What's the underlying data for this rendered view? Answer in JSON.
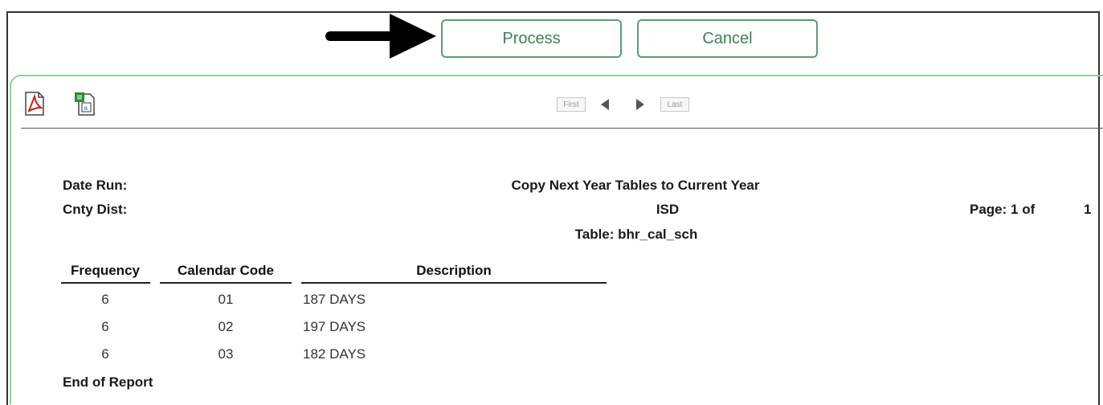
{
  "actions": {
    "process_label": "Process",
    "cancel_label": "Cancel"
  },
  "toolbar": {
    "icons": [
      "pdf-icon",
      "excel-icon"
    ],
    "first_label": "First",
    "last_label": "Last"
  },
  "report": {
    "date_run_label": "Date Run:",
    "cnty_dist_label": "Cnty Dist:",
    "title": "Copy Next Year Tables to Current Year",
    "district": "ISD",
    "table_line": "Table: bhr_cal_sch",
    "page_label": "Page: 1 of",
    "page_total": "1",
    "columns": [
      "Frequency",
      "Calendar Code",
      "Description"
    ],
    "rows": [
      {
        "frequency": "6",
        "calendar_code": "01",
        "description": "187 DAYS"
      },
      {
        "frequency": "6",
        "calendar_code": "02",
        "description": "197 DAYS"
      },
      {
        "frequency": "6",
        "calendar_code": "03",
        "description": "182 DAYS"
      }
    ],
    "footer": "End of Report"
  },
  "colors": {
    "button_border": "#5a9e6f",
    "button_text": "#3d8058",
    "panel_border": "#8fd0a0"
  }
}
